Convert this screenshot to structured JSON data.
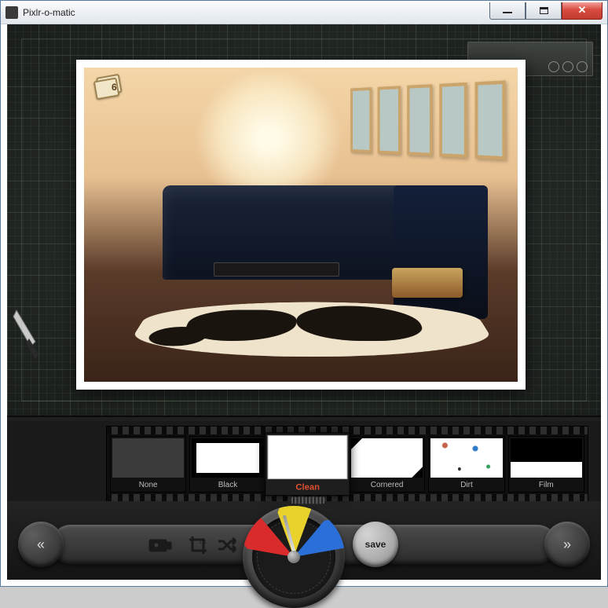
{
  "window": {
    "title": "Pixlr-o-matic"
  },
  "photo": {
    "badge_count": "6"
  },
  "filmstrip": {
    "items": [
      {
        "label": "None"
      },
      {
        "label": "Black"
      },
      {
        "label": "Clean"
      },
      {
        "label": "Cornered"
      },
      {
        "label": "Dirt"
      },
      {
        "label": "Film"
      }
    ],
    "selected_index": 2
  },
  "toolbar": {
    "save_label": "save",
    "prev_glyph": "«",
    "next_glyph": "»"
  }
}
